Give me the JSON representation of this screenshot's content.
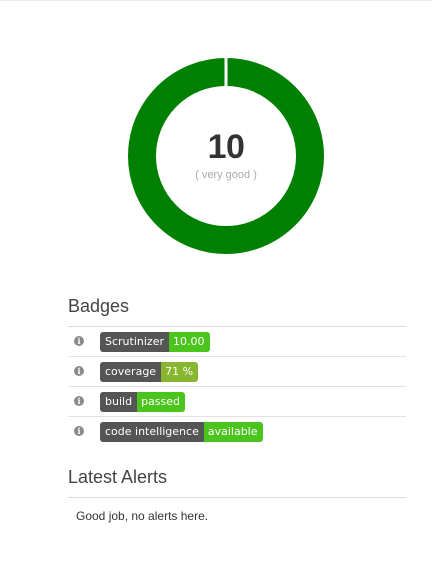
{
  "score": {
    "value": "10",
    "label": "( very good )",
    "rating_fraction": 1.0,
    "ring_color": "#008000"
  },
  "badges": {
    "title": "Badges",
    "info_icon": "info-icon",
    "items": [
      {
        "label": "Scrutinizer",
        "value": "10.00",
        "value_color": "#4bc51e"
      },
      {
        "label": "coverage",
        "value": "71 %",
        "value_color": "#89b62f"
      },
      {
        "label": "build",
        "value": "passed",
        "value_color": "#4bc51e"
      },
      {
        "label": "code intelligence",
        "value": "available",
        "value_color": "#4bc51e"
      }
    ]
  },
  "alerts": {
    "title": "Latest Alerts",
    "message": "Good job, no alerts here."
  }
}
